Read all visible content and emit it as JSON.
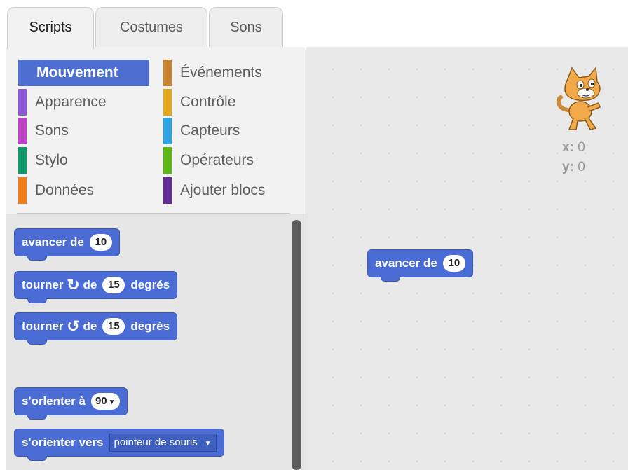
{
  "tabs": [
    {
      "label": "Scripts",
      "active": true
    },
    {
      "label": "Costumes",
      "active": false
    },
    {
      "label": "Sons",
      "active": false
    }
  ],
  "categories": [
    {
      "label": "Mouvement",
      "color": "#4c6fd1",
      "selected": true
    },
    {
      "label": "Apparence",
      "color": "#8a55d7"
    },
    {
      "label": "Sons",
      "color": "#bb42c3"
    },
    {
      "label": "Stylo",
      "color": "#0e9a6c"
    },
    {
      "label": "Données",
      "color": "#ee7d16"
    },
    {
      "label": "Événements",
      "color": "#c88330"
    },
    {
      "label": "Contrôle",
      "color": "#e1a91a"
    },
    {
      "label": "Capteurs",
      "color": "#2ca5e2"
    },
    {
      "label": "Opérateurs",
      "color": "#5cb712"
    },
    {
      "label": "Ajouter blocs",
      "color": "#632d99"
    }
  ],
  "palette_blocks": {
    "move": {
      "text": "avancer de",
      "value": "10"
    },
    "turn_right": {
      "text_before": "tourner",
      "icon": "rotate-clockwise-icon",
      "text_mid": "de",
      "value": "15",
      "text_after": "degrés"
    },
    "turn_left": {
      "text_before": "tourner",
      "icon": "rotate-counterclockwise-icon",
      "text_mid": "de",
      "value": "15",
      "text_after": "degrés"
    },
    "point_direction": {
      "text": "s'orlenter à",
      "value": "90"
    },
    "point_towards": {
      "text": "s'orienter vers",
      "option": "pointeur de souris"
    }
  },
  "script_area": {
    "block": {
      "text": "avancer de",
      "value": "10"
    },
    "sprite": "cat-sprite",
    "x_label": "x:",
    "x_value": "0",
    "y_label": "y:",
    "y_value": "0"
  }
}
